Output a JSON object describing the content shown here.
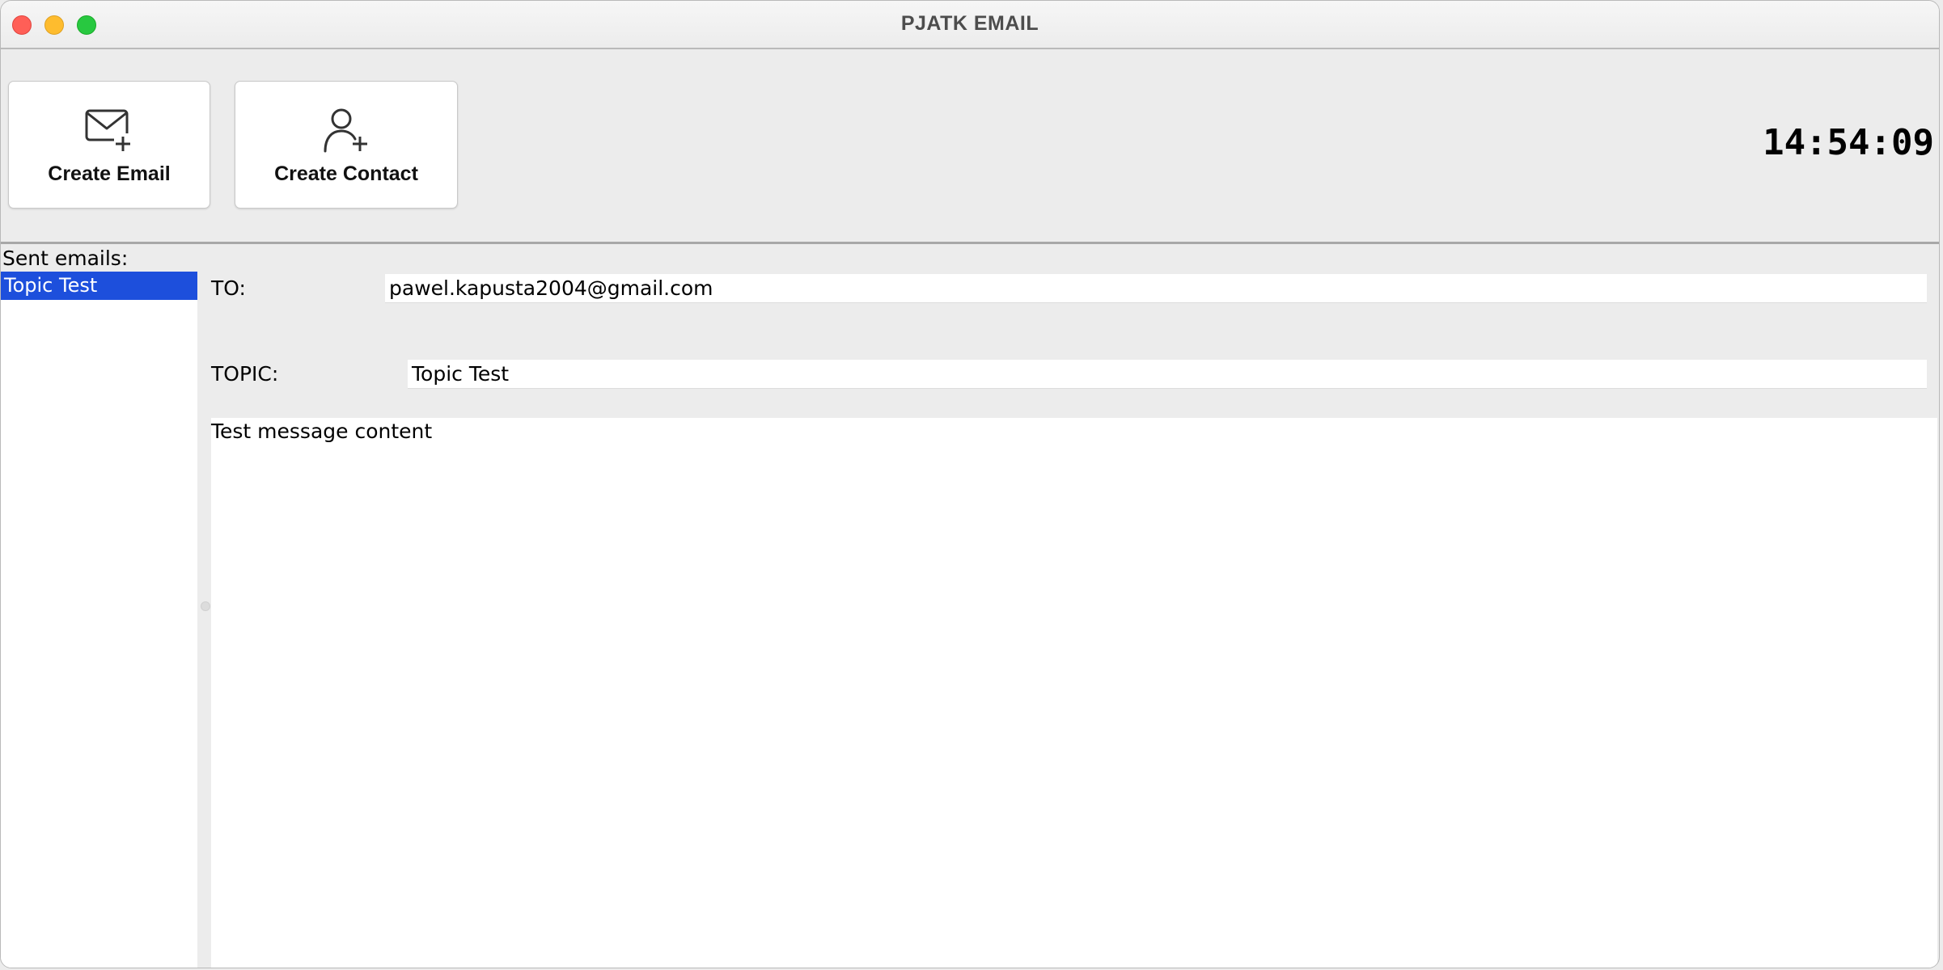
{
  "window": {
    "title": "PJATK EMAIL"
  },
  "toolbar": {
    "create_email_label": "Create Email",
    "create_email_icon": "mail-plus-icon",
    "create_contact_label": "Create Contact",
    "create_contact_icon": "user-plus-icon",
    "clock": "14:54:09"
  },
  "sidebar": {
    "heading": "Sent emails:",
    "items": [
      {
        "label": "Topic Test",
        "selected": true
      }
    ]
  },
  "email": {
    "to_label": "TO:",
    "to_value": "pawel.kapusta2004@gmail.com",
    "topic_label": "TOPIC:",
    "topic_value": "Topic Test",
    "body": "Test message content"
  },
  "colors": {
    "selection": "#1d4fdc",
    "background": "#ececec",
    "close": "#ff5f57",
    "minimize": "#febc2e",
    "maximize": "#28c840"
  }
}
